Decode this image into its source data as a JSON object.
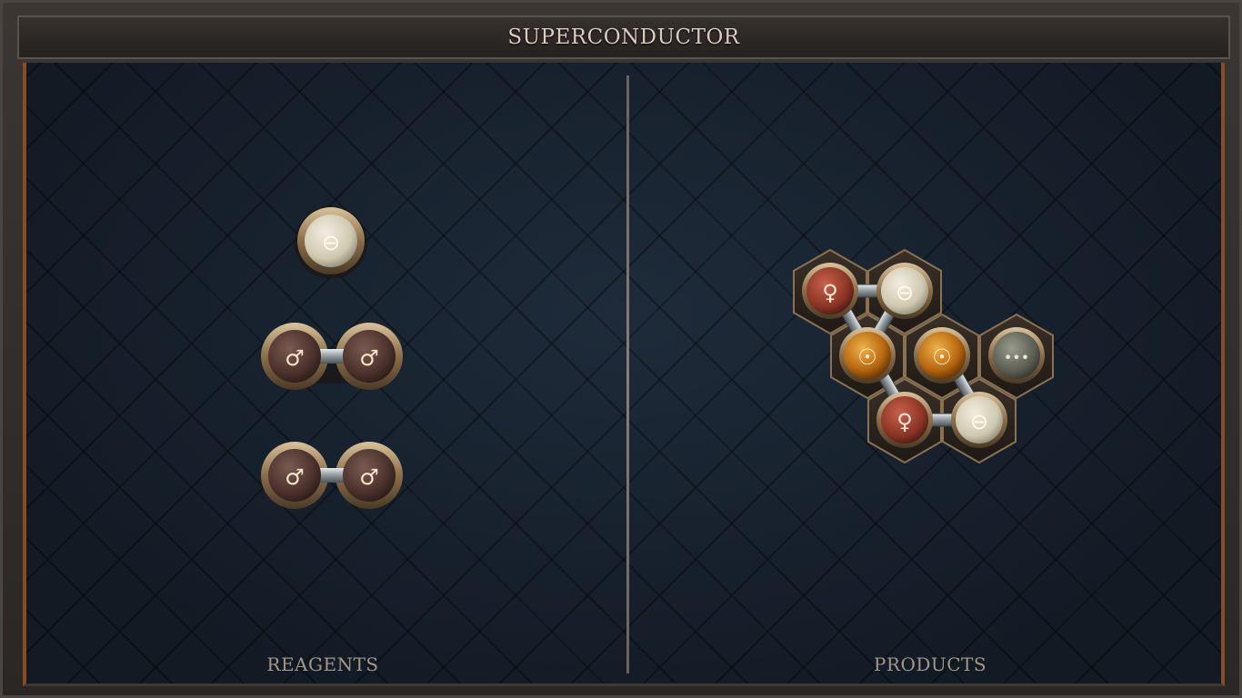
{
  "header": {
    "title": "SUPERCONDUCTOR"
  },
  "panels": {
    "reagents_label": "REAGENTS",
    "products_label": "PRODUCTS"
  },
  "atom_types": {
    "salt": {
      "symbol": "⊖",
      "color": "#d8d2bd",
      "icon": "salt-icon"
    },
    "iron": {
      "symbol": "♂",
      "color": "#5a3e38",
      "icon": "iron-icon"
    },
    "copper": {
      "symbol": "♀",
      "color": "#9a3c2c",
      "icon": "copper-icon"
    },
    "gold": {
      "symbol": "☉",
      "color": "#c87a1a",
      "icon": "gold-icon"
    },
    "quintessence": {
      "symbol": "•••",
      "color": "#6a6b60",
      "icon": "quintessence-icon"
    }
  },
  "reagents": [
    {
      "atoms": [
        "salt"
      ]
    },
    {
      "atoms": [
        "iron",
        "iron"
      ]
    },
    {
      "atoms": [
        "iron",
        "iron"
      ]
    }
  ],
  "product": {
    "atoms": [
      "copper",
      "salt",
      "gold",
      "gold",
      "quintessence",
      "copper",
      "salt"
    ]
  }
}
